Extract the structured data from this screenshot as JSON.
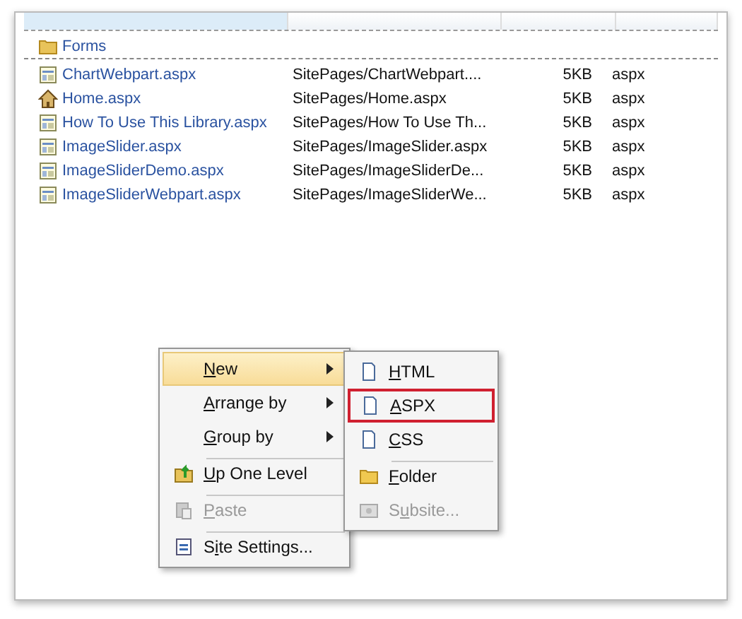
{
  "folders": [
    {
      "name": "Forms",
      "kind": "folder"
    }
  ],
  "files": [
    {
      "name": "ChartWebpart.aspx",
      "kind": "page",
      "title": "SitePages/ChartWebpart....",
      "size": "5KB",
      "type": "aspx"
    },
    {
      "name": "Home.aspx",
      "kind": "home",
      "title": "SitePages/Home.aspx",
      "size": "5KB",
      "type": "aspx"
    },
    {
      "name": "How To Use This Library.aspx",
      "kind": "page",
      "title": "SitePages/How To Use Th...",
      "size": "5KB",
      "type": "aspx"
    },
    {
      "name": "ImageSlider.aspx",
      "kind": "page",
      "title": "SitePages/ImageSlider.aspx",
      "size": "5KB",
      "type": "aspx"
    },
    {
      "name": "ImageSliderDemo.aspx",
      "kind": "page",
      "title": "SitePages/ImageSliderDe...",
      "size": "5KB",
      "type": "aspx"
    },
    {
      "name": "ImageSliderWebpart.aspx",
      "kind": "page",
      "title": "SitePages/ImageSliderWe...",
      "size": "5KB",
      "type": "aspx"
    }
  ],
  "context_menu": [
    {
      "key": "N",
      "after": "ew",
      "kind": "plain",
      "submenu": true,
      "selected": true,
      "disabled": false,
      "separator_before": false
    },
    {
      "key": "A",
      "after": "rrange by",
      "kind": "plain",
      "submenu": true,
      "selected": false,
      "disabled": false,
      "separator_before": false
    },
    {
      "key": "G",
      "after": "roup by",
      "kind": "plain",
      "submenu": true,
      "selected": false,
      "disabled": false,
      "separator_before": false
    },
    {
      "key": "U",
      "after": "p One Level",
      "kind": "up-folder",
      "submenu": false,
      "selected": false,
      "disabled": false,
      "separator_before": true
    },
    {
      "key": "P",
      "after": "aste",
      "kind": "clipboard",
      "submenu": false,
      "selected": false,
      "disabled": true,
      "separator_before": true
    },
    {
      "before": "S",
      "key": "i",
      "after": "te Settings...",
      "kind": "settings",
      "submenu": false,
      "selected": false,
      "disabled": false,
      "separator_before": true
    }
  ],
  "submenu": [
    {
      "key": "H",
      "after": "TML",
      "kind": "page",
      "disabled": false,
      "outlined": false,
      "separator_before": false
    },
    {
      "key": "A",
      "after": "SPX",
      "kind": "page",
      "disabled": false,
      "outlined": true,
      "separator_before": false
    },
    {
      "key": "C",
      "after": "SS",
      "kind": "page",
      "disabled": false,
      "outlined": false,
      "separator_before": false
    },
    {
      "key": "F",
      "after": "older",
      "kind": "folder",
      "disabled": false,
      "outlined": false,
      "separator_before": true
    },
    {
      "before": "S",
      "key": "u",
      "after": "bsite...",
      "kind": "site",
      "disabled": true,
      "outlined": false,
      "separator_before": false
    }
  ]
}
